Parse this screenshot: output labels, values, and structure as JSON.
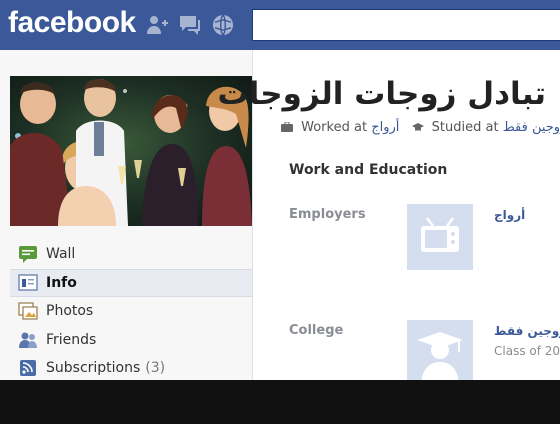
{
  "topbar": {
    "logo": "facebook",
    "jewels": [
      "friend-requests-icon",
      "messages-icon",
      "notifications-icon"
    ]
  },
  "profile": {
    "name": "تبادل زوجات الزوجات",
    "worked_label": "Worked at",
    "worked_value": "أرواج",
    "studied_label": "Studied at",
    "studied_value": "زوجين فقط"
  },
  "nav": {
    "items": [
      {
        "label": "Wall",
        "icon": "wall-icon"
      },
      {
        "label": "Info",
        "icon": "info-icon"
      },
      {
        "label": "Photos",
        "icon": "photos-icon"
      },
      {
        "label": "Friends",
        "icon": "friends-icon"
      },
      {
        "label": "Subscriptions",
        "icon": "subscriptions-icon",
        "count": "(3)"
      }
    ],
    "active": "Info"
  },
  "work_education": {
    "title": "Work and Education",
    "employers_label": "Employers",
    "employer_name": "أرواج",
    "college_label": "College",
    "college_name": "زوجين فقط",
    "college_class": "Class of 20"
  },
  "colors": {
    "brand": "#3b5998",
    "page": "#f3f4f6",
    "tile": "#d5deee"
  }
}
